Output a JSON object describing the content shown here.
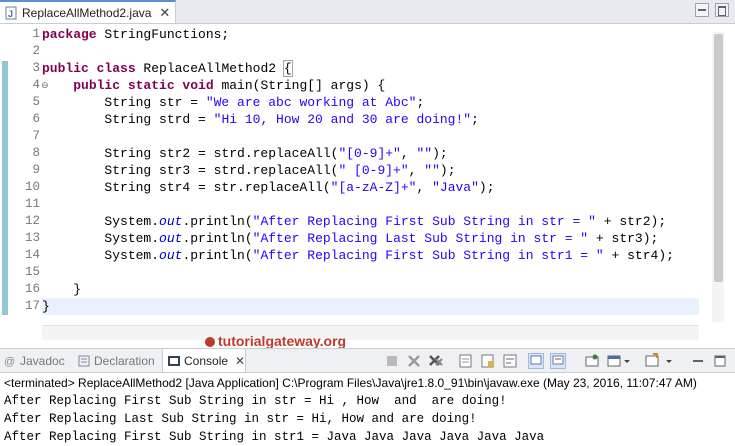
{
  "editor_tab": {
    "label": "ReplaceAllMethod2.java",
    "close": "✕"
  },
  "code": {
    "line_numbers": [
      "1",
      "2",
      "3",
      "4",
      "5",
      "6",
      "7",
      "8",
      "9",
      "10",
      "11",
      "12",
      "13",
      "14",
      "15",
      "16",
      "17"
    ],
    "lines": [
      [
        {
          "t": "package",
          "c": "kw"
        },
        {
          "t": " StringFunctions;",
          "c": ""
        }
      ],
      [],
      [
        {
          "t": "public class",
          "c": "kw"
        },
        {
          "t": " ReplaceAllMethod2 ",
          "c": ""
        },
        {
          "t": "{",
          "c": "brk"
        }
      ],
      [
        {
          "t": "    ",
          "c": ""
        },
        {
          "t": "public static void",
          "c": "kw"
        },
        {
          "t": " main(String[] args) {",
          "c": ""
        }
      ],
      [
        {
          "t": "        String str = ",
          "c": ""
        },
        {
          "t": "\"We are abc working at Abc\"",
          "c": "str"
        },
        {
          "t": ";",
          "c": ""
        }
      ],
      [
        {
          "t": "        String strd = ",
          "c": ""
        },
        {
          "t": "\"Hi 10, How 20 and 30 are doing!\"",
          "c": "str"
        },
        {
          "t": ";",
          "c": ""
        }
      ],
      [],
      [
        {
          "t": "        String str2 = strd.replaceAll(",
          "c": ""
        },
        {
          "t": "\"[0-9]+\"",
          "c": "str"
        },
        {
          "t": ", ",
          "c": ""
        },
        {
          "t": "\"\"",
          "c": "str"
        },
        {
          "t": ");",
          "c": ""
        }
      ],
      [
        {
          "t": "        String str3 = strd.replaceAll(",
          "c": ""
        },
        {
          "t": "\" [0-9]+\"",
          "c": "str"
        },
        {
          "t": ", ",
          "c": ""
        },
        {
          "t": "\"\"",
          "c": "str"
        },
        {
          "t": ");",
          "c": ""
        }
      ],
      [
        {
          "t": "        String str4 = str.replaceAll(",
          "c": ""
        },
        {
          "t": "\"[a-zA-Z]+\"",
          "c": "str"
        },
        {
          "t": ", ",
          "c": ""
        },
        {
          "t": "\"Java\"",
          "c": "str"
        },
        {
          "t": ");",
          "c": ""
        }
      ],
      [],
      [
        {
          "t": "        System.",
          "c": ""
        },
        {
          "t": "out",
          "c": "fld"
        },
        {
          "t": ".println(",
          "c": ""
        },
        {
          "t": "\"After Replacing First Sub String in str = \"",
          "c": "str"
        },
        {
          "t": " + str2);",
          "c": ""
        }
      ],
      [
        {
          "t": "        System.",
          "c": ""
        },
        {
          "t": "out",
          "c": "fld"
        },
        {
          "t": ".println(",
          "c": ""
        },
        {
          "t": "\"After Replacing Last Sub String in str = \"",
          "c": "str"
        },
        {
          "t": " + str3);",
          "c": ""
        }
      ],
      [
        {
          "t": "        System.",
          "c": ""
        },
        {
          "t": "out",
          "c": "fld"
        },
        {
          "t": ".println(",
          "c": ""
        },
        {
          "t": "\"After Replacing First Sub String in str1 = \"",
          "c": "str"
        },
        {
          "t": " + str4);",
          "c": ""
        }
      ],
      [],
      [
        {
          "t": "    }",
          "c": ""
        }
      ],
      [
        {
          "t": "}",
          "c": ""
        }
      ]
    ]
  },
  "watermark": {
    "text": "tutorialgateway.org"
  },
  "views": {
    "tabs": [
      {
        "label": "Javadoc",
        "icon": "at-icon",
        "active": false
      },
      {
        "label": "Declaration",
        "icon": "declaration-icon",
        "active": false
      },
      {
        "label": "Console",
        "icon": "console-icon",
        "active": true
      }
    ],
    "close": "✕"
  },
  "console": {
    "terminated": "<terminated> ReplaceAllMethod2 [Java Application] C:\\Program Files\\Java\\jre1.8.0_91\\bin\\javaw.exe (May 23, 2016, 11:07:47 AM)",
    "output": [
      "After Replacing First Sub String in str = Hi , How  and  are doing!",
      "After Replacing Last Sub String in str = Hi, How and are doing!",
      "After Replacing First Sub String in str1 = Java Java Java Java Java Java"
    ]
  },
  "colors": {
    "keyword": "#7f0055",
    "string": "#2a00ff",
    "field": "#0000c0",
    "watermark": "#c0392b"
  }
}
